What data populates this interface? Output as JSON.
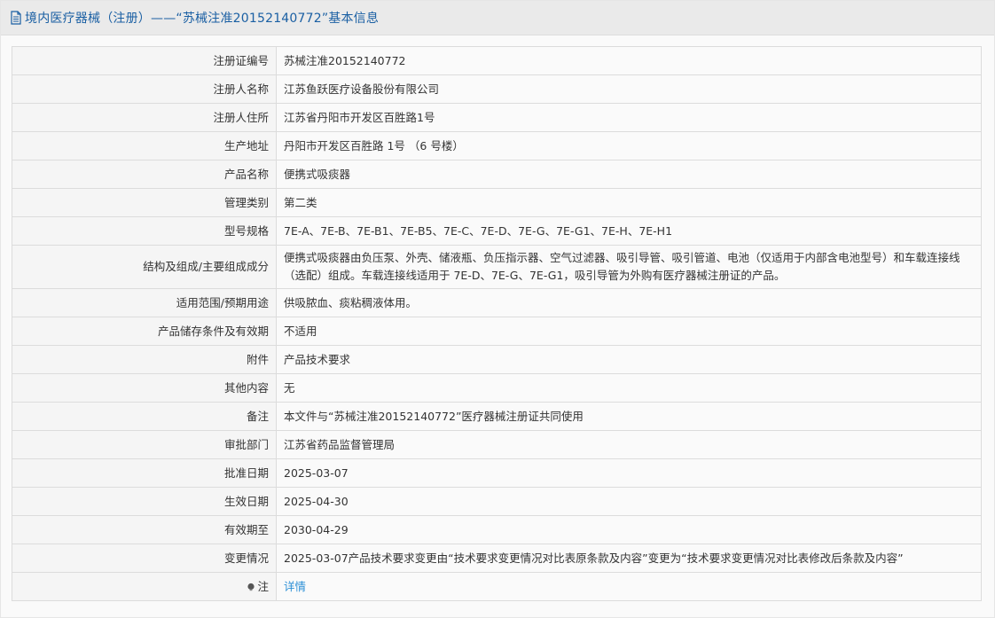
{
  "header": {
    "title": "境内医疗器械（注册）——“苏械注准20152140772”基本信息",
    "icon": "document-icon"
  },
  "rows": [
    {
      "label": "注册证编号",
      "value": "苏械注准20152140772"
    },
    {
      "label": "注册人名称",
      "value": "江苏鱼跃医疗设备股份有限公司"
    },
    {
      "label": "注册人住所",
      "value": "江苏省丹阳市开发区百胜路1号"
    },
    {
      "label": "生产地址",
      "value": "丹阳市开发区百胜路 1号 （6 号楼）"
    },
    {
      "label": "产品名称",
      "value": "便携式吸痰器"
    },
    {
      "label": "管理类别",
      "value": "第二类"
    },
    {
      "label": "型号规格",
      "value": "7E-A、7E-B、7E-B1、7E-B5、7E-C、7E-D、7E-G、7E-G1、7E-H、7E-H1"
    },
    {
      "label": "结构及组成/主要组成成分",
      "value": "便携式吸痰器由负压泵、外壳、储液瓶、负压指示器、空气过滤器、吸引导管、吸引管道、电池（仅适用于内部含电池型号）和车载连接线（选配）组成。车载连接线适用于 7E-D、7E-G、7E-G1，吸引导管为外购有医疗器械注册证的产品。"
    },
    {
      "label": "适用范围/预期用途",
      "value": "供吸脓血、痰粘稠液体用。"
    },
    {
      "label": "产品储存条件及有效期",
      "value": "不适用"
    },
    {
      "label": "附件",
      "value": "产品技术要求"
    },
    {
      "label": "其他内容",
      "value": "无"
    },
    {
      "label": "备注",
      "value": "本文件与“苏械注准20152140772”医疗器械注册证共同使用"
    },
    {
      "label": "审批部门",
      "value": "江苏省药品监督管理局"
    },
    {
      "label": "批准日期",
      "value": "2025-03-07"
    },
    {
      "label": "生效日期",
      "value": "2025-04-30"
    },
    {
      "label": "有效期至",
      "value": "2030-04-29"
    },
    {
      "label": "变更情况",
      "value": "2025-03-07产品技术要求变更由“技术要求变更情况对比表原条款及内容”变更为“技术要求变更情况对比表修改后条款及内容”"
    }
  ],
  "note": {
    "label": "注",
    "icon": "info-bulb-icon",
    "link_text": "详情"
  },
  "colors": {
    "header_text": "#1a5fa3",
    "link": "#2b8fd6",
    "border": "#dcdcdc"
  }
}
